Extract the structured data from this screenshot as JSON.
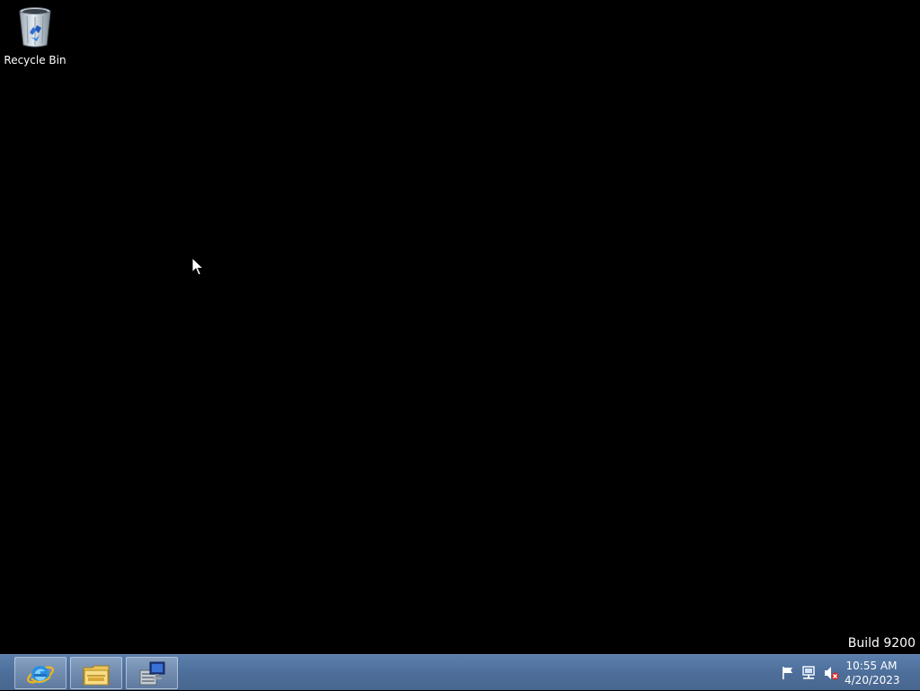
{
  "desktop": {
    "icons": [
      {
        "label": "Recycle Bin",
        "icon": "recycle-bin-icon"
      }
    ],
    "watermark": "Build 9200"
  },
  "taskbar": {
    "pinned": [
      {
        "name": "Internet Explorer",
        "icon": "internet-explorer-icon"
      },
      {
        "name": "File Explorer",
        "icon": "file-explorer-icon"
      },
      {
        "name": "Server Manager",
        "icon": "server-manager-icon"
      }
    ],
    "tray": {
      "icons": [
        "action-center-flag-icon",
        "network-icon",
        "volume-muted-icon"
      ],
      "time": "10:55 AM",
      "date": "4/20/2023"
    }
  },
  "colors": {
    "desktop_background": "#000000",
    "taskbar": "#4e6f9b",
    "text": "#ffffff"
  }
}
